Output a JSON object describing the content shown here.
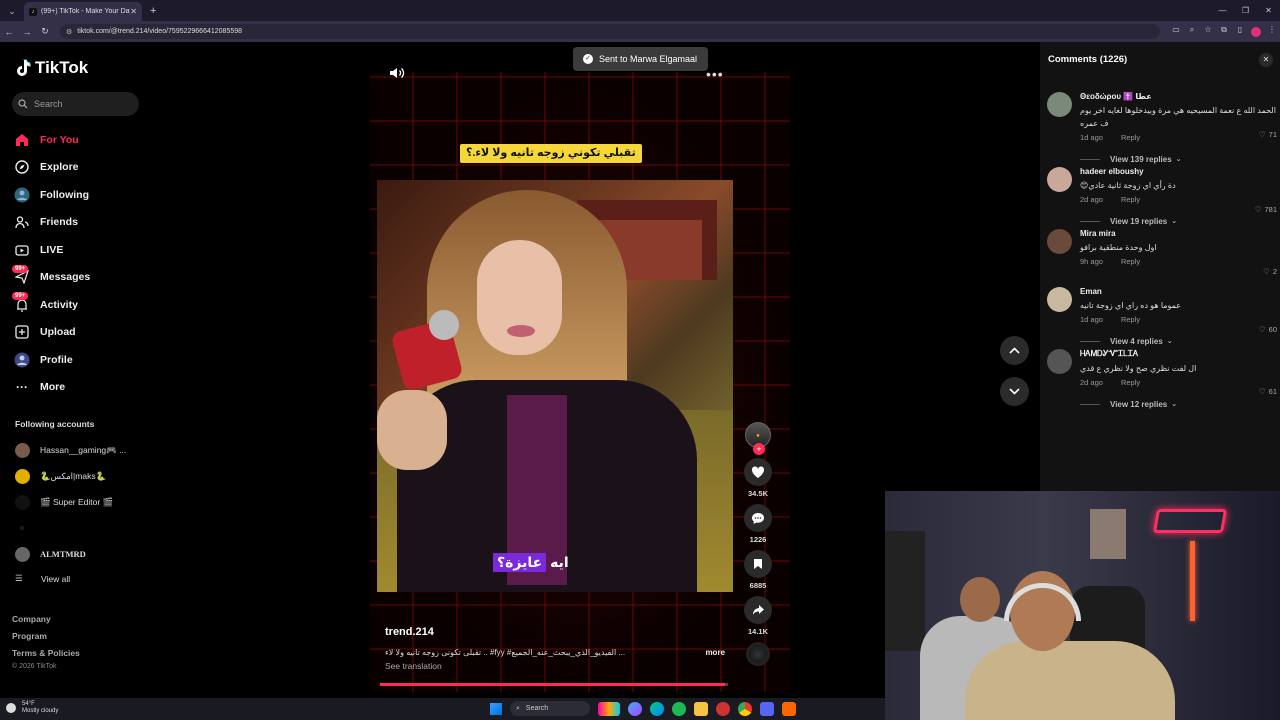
{
  "browser": {
    "tab_title": "(99+) TikTok - Make Your Day",
    "url": "tiktok.com/@trend.214/video/7595229666412085598",
    "new_tab": "+",
    "close": "✕"
  },
  "sidebar": {
    "logo": "TikTok",
    "search_placeholder": "Search",
    "menu": [
      {
        "label": "For You",
        "icon": "home-icon"
      },
      {
        "label": "Explore",
        "icon": "compass-icon"
      },
      {
        "label": "Following",
        "icon": "following-icon"
      },
      {
        "label": "Friends",
        "icon": "friends-icon"
      },
      {
        "label": "LIVE",
        "icon": "live-icon"
      },
      {
        "label": "Messages",
        "icon": "messages-icon",
        "badge": "99+"
      },
      {
        "label": "Activity",
        "icon": "activity-icon",
        "badge": "99+"
      },
      {
        "label": "Upload",
        "icon": "upload-icon"
      },
      {
        "label": "Profile",
        "icon": "profile-icon"
      },
      {
        "label": "More",
        "icon": "more-icon"
      }
    ],
    "following_title": "Following accounts",
    "accounts": [
      {
        "name": "Hassan__gaming🎮 ..."
      },
      {
        "name": "🐍امكس|maks🐍"
      },
      {
        "name": "🎬 Super Editor 🎬"
      },
      {
        "name": ""
      },
      {
        "name": "ALMTMRD"
      }
    ],
    "view_all": "View all",
    "footer": [
      "Company",
      "Program",
      "Terms & Policies"
    ],
    "copyright": "© 2026 TikTok"
  },
  "video": {
    "toast": "Sent to Marwa Elgamaal",
    "caption_top": "تقبلي تكوني زوجه تانيه ولا لاء.؟",
    "caption_bottom_plain": "ايه",
    "caption_bottom_highlight": "عايزة؟",
    "author": "trend.214",
    "description": "... الفيديو_الذي_يبحث_عنه_الجميع# fyy# .. تقبلى تكونى زوجه تانيه ولا لاء",
    "more": "more",
    "see_translation": "See translation",
    "progress": 0.99,
    "likes": "34.5K",
    "comments": "1226",
    "saves": "6885",
    "shares": "14.1K",
    "plus": "+"
  },
  "comments_panel": {
    "title": "Comments (1226)",
    "close": "✕",
    "items": [
      {
        "name": "Θεοδώρου ✝️ عطا",
        "text": "الحمد الله ع نعمة المسيحيه هي مرة وبيدخلوها لغايه اخر يوم ف عمره",
        "time": "1d ago",
        "reply": "Reply",
        "likes": "71",
        "view_replies": "View 139 replies",
        "avatar_color": "#7a8a7a"
      },
      {
        "name": "hadeer elboushy",
        "text": "دة رأي اي زوجة ثانية عادي😊",
        "time": "2d ago",
        "reply": "Reply",
        "likes": "781",
        "view_replies": "View 19 replies",
        "avatar_color": "#c9a89a"
      },
      {
        "name": "Mira mira",
        "text": "اول وحدة منطقية برافو",
        "time": "9h ago",
        "reply": "Reply",
        "likes": "2",
        "view_replies": "",
        "avatar_color": "#6a4a3a"
      },
      {
        "name": "Eman",
        "text": "عموما هو ده راي اي زوجة تانيه",
        "time": "1d ago",
        "reply": "Reply",
        "likes": "60",
        "view_replies": "View 4 replies",
        "avatar_color": "#c8b8a0"
      },
      {
        "name": "ᎻᎪᎷᎠᎽᏉᏆᏞᏆᎪ",
        "text": "ال لفت نظري صح ولا نظري ع قدي",
        "time": "2d ago",
        "reply": "Reply",
        "likes": "61",
        "view_replies": "View 12 replies",
        "avatar_color": "#555"
      }
    ]
  },
  "taskbar": {
    "temp": "54°F",
    "weather": "Mostly cloudy",
    "search": "Search"
  },
  "colors": {
    "accent": "#fe2c55",
    "caption_yellow": "#f5d73b",
    "highlight_purple": "#7a2ad8"
  }
}
